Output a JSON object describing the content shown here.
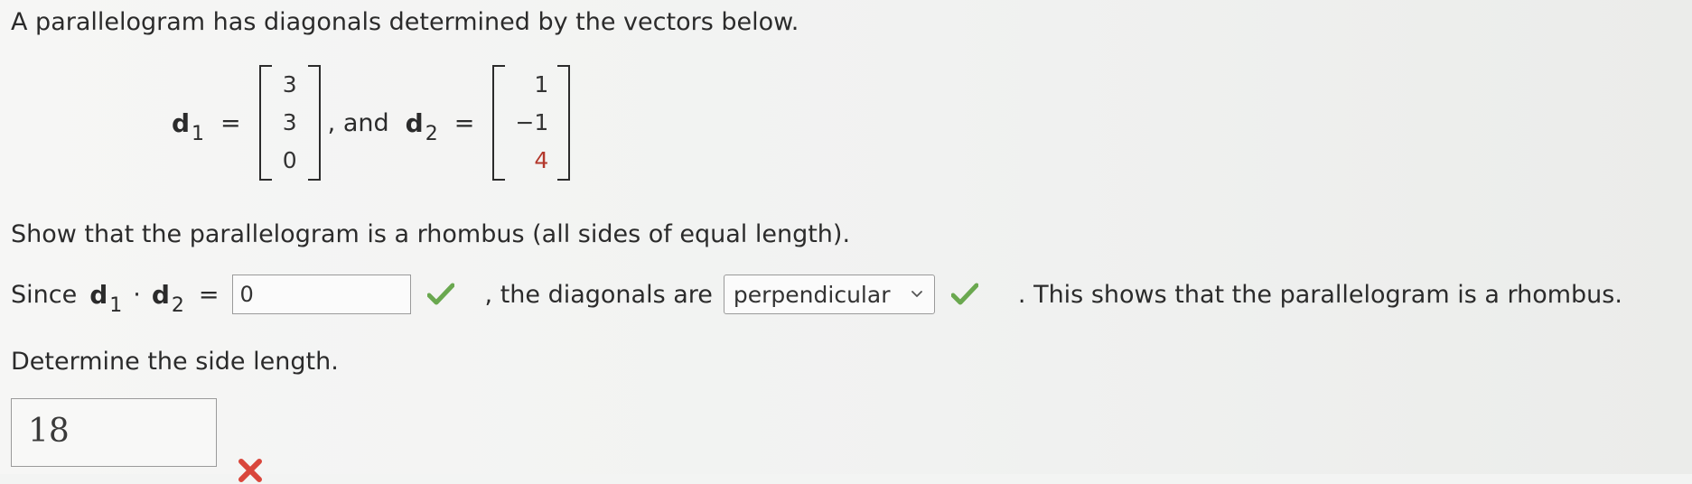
{
  "intro": "A parallelogram has diagonals determined by the vectors below.",
  "vectors": {
    "d1": {
      "name": "d",
      "sub": "1",
      "values": [
        "3",
        "3",
        "0"
      ]
    },
    "d2": {
      "name": "d",
      "sub": "2",
      "values": [
        "1",
        "−1",
        "4"
      ]
    },
    "eq": "=",
    "and": ", and"
  },
  "show": "Show that the parallelogram is a rhombus (all sides of equal length).",
  "since": {
    "prefix": "Since",
    "dot": "·",
    "eq": "=",
    "answer_value": "0",
    "answer_status": "correct",
    "middle": ", the diagonals are",
    "select_value": "perpendicular",
    "select_status": "correct",
    "suffix": ". This shows that the parallelogram is a rhombus."
  },
  "determine": "Determine the side length.",
  "side_length": {
    "value": "18",
    "status": "incorrect"
  },
  "colors": {
    "check": "#6aa84f",
    "cross": "#d9463b",
    "accent_red": "#b3382c"
  },
  "icons": {
    "correct": "check-icon",
    "incorrect": "cross-icon",
    "dropdown": "chevron-down-icon"
  }
}
